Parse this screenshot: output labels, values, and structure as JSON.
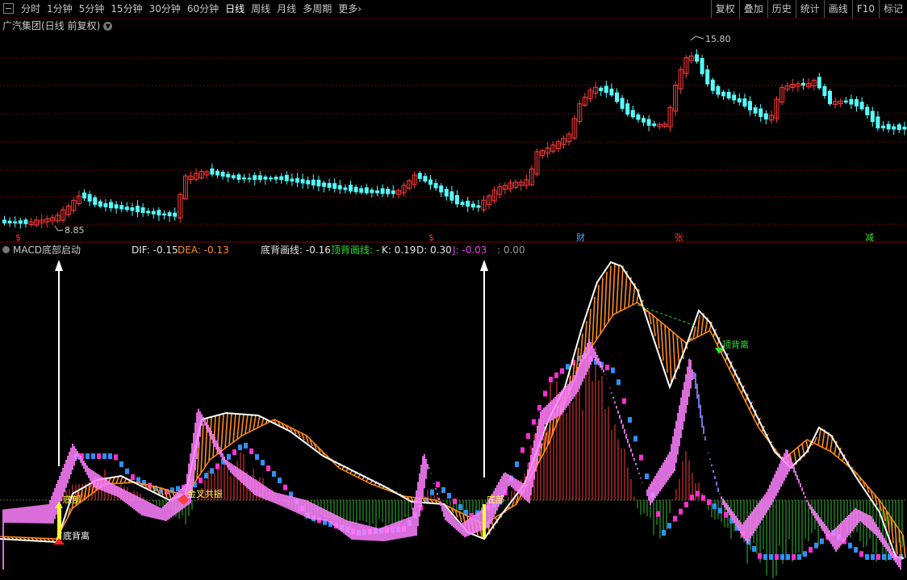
{
  "toolbar": {
    "periods": [
      "分时",
      "1分钟",
      "5分钟",
      "15分钟",
      "30分钟",
      "60分钟",
      "日线",
      "周线",
      "月线",
      "多周期",
      "更多"
    ],
    "active_period": "日线",
    "more_arrow": "›",
    "right_buttons": [
      "复权",
      "叠加",
      "历史",
      "统计",
      "画线",
      "F10",
      "标记"
    ]
  },
  "title": {
    "stock": "广汽集团(日线 前复权)",
    "dropdown_icon": "chevron-down-icon"
  },
  "price_panel": {
    "high_label": "15.80",
    "low_label": "8.85",
    "markers": [
      {
        "text": "$",
        "color": "#ff3030"
      },
      {
        "text": "$",
        "color": "#ff3030"
      },
      {
        "text": "财",
        "color": "#5aa0ff"
      },
      {
        "text": "张",
        "color": "#ff3030"
      },
      {
        "text": "减",
        "color": "#40e040"
      }
    ]
  },
  "indicator": {
    "name": "MACD底部启动",
    "values": [
      {
        "label": "DIF: -0.15",
        "color": "#e6e6e6"
      },
      {
        "label": "DEA: -0.13",
        "color": "#ff8c1a"
      },
      {
        "label": "底背画线: -0.16",
        "color": "#e6e6e6"
      },
      {
        "label": "顶背画线: -",
        "color": "#30e030"
      },
      {
        "label": "K: 0.19",
        "color": "#e6e6e6"
      },
      {
        "label": "D: 0.30",
        "color": "#e6e6e6"
      },
      {
        "label": "J: -0.03",
        "color": "#e040e0"
      },
      {
        "label": ": 0.00",
        "color": "#9a9a9a"
      }
    ],
    "annotations": {
      "bottom_div": "底背离",
      "bottom1": "底部",
      "golden_cross": "金叉共振",
      "bottom2": "底部",
      "top_div": "顶背离"
    }
  },
  "colors": {
    "up": "#ff3b3b",
    "down": "#54ffff",
    "grid": "#7a0000",
    "dif": "#ffffff",
    "band": "#ff8c1a",
    "pink": "#ff80ff",
    "purple": "#8888ff"
  }
}
